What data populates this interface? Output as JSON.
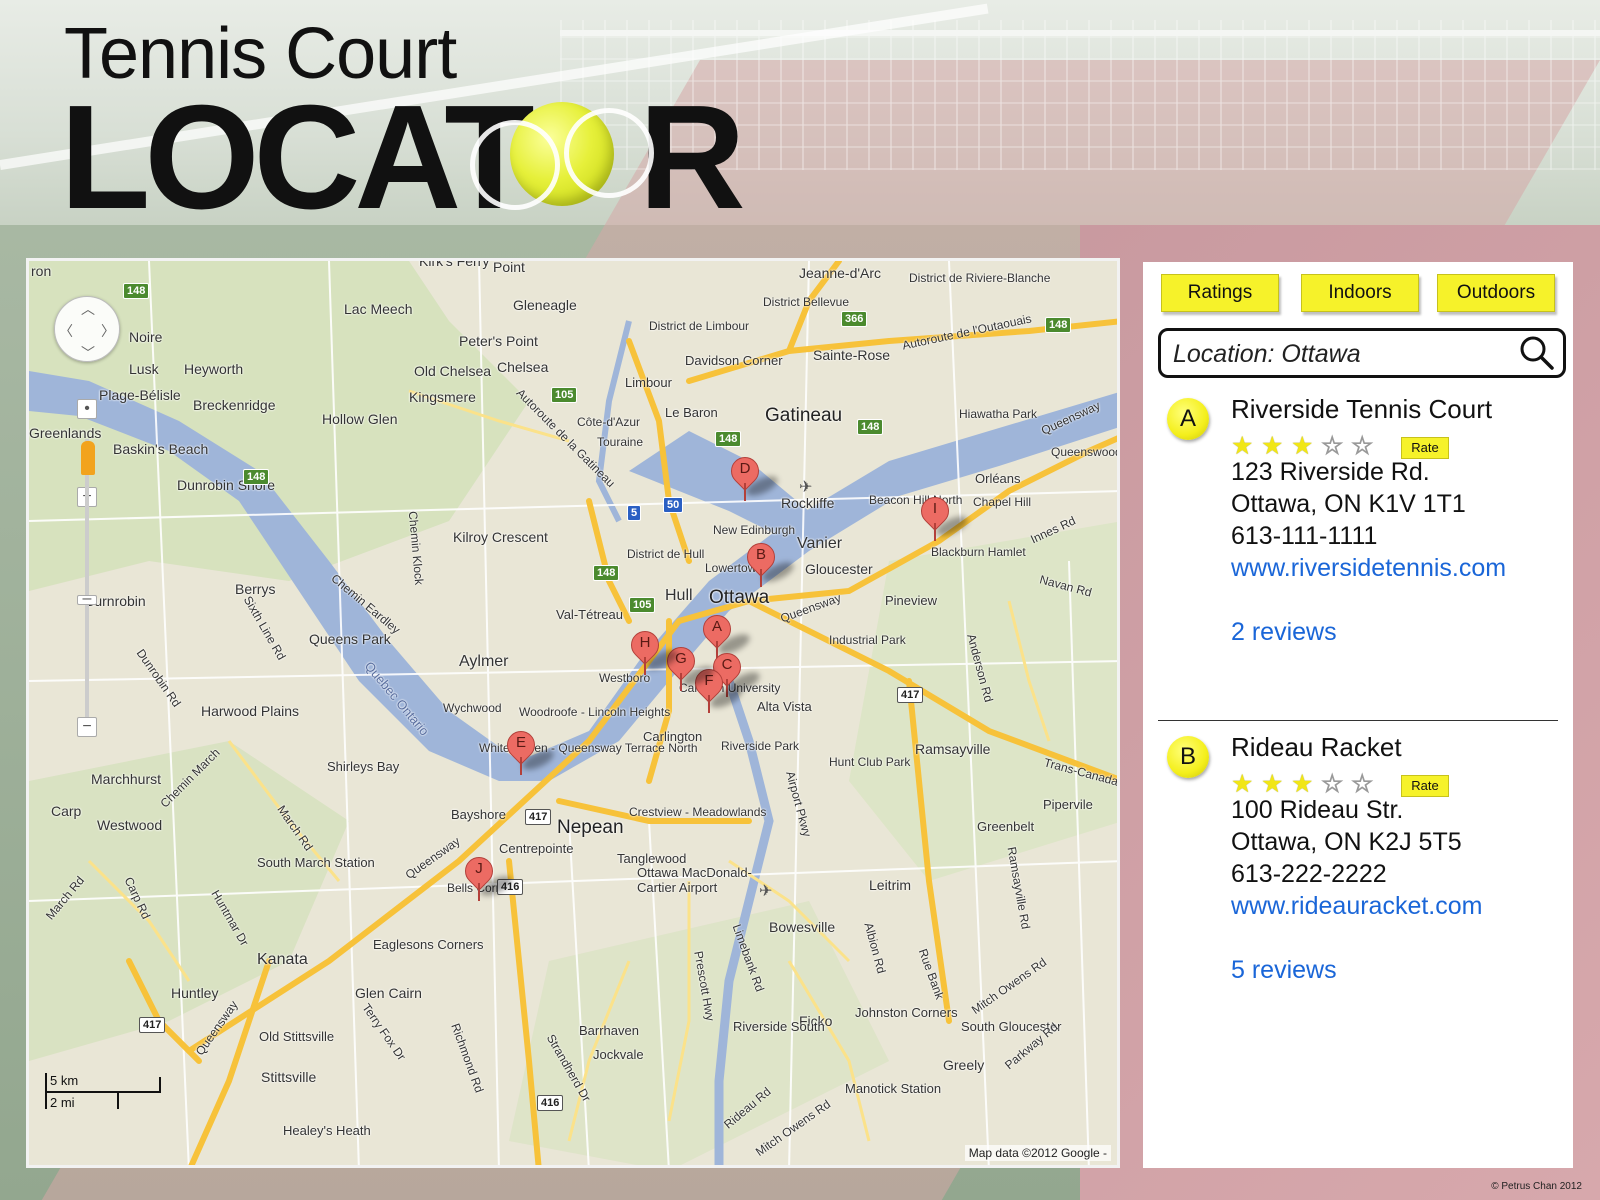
{
  "logo": {
    "line1": "Tennis Court",
    "line2_left": "LOCAT",
    "line2_right": "R"
  },
  "map": {
    "places": {
      "ottawa": "Ottawa",
      "gatineau": "Gatineau",
      "hull": "Hull",
      "nepean": "Nepean",
      "kanata": "Kanata",
      "aylmer": "Aylmer",
      "vanier": "Vanier",
      "gloucester": "Gloucester",
      "rockliffe": "Rockliffe",
      "orleans": "Orléans",
      "westboro": "Westboro",
      "carlington": "Carlington",
      "alta_vista": "Alta Vista",
      "riverside_park": "Riverside Park",
      "hunt_club_park": "Hunt Club Park",
      "ramsayville": "Ramsayville",
      "leitrim": "Leitrim",
      "bowesville": "Bowesville",
      "greenbelt": "Greenbelt",
      "pipervile": "Pipervile",
      "pineview": "Pineview",
      "industrial_park": "Industrial Park",
      "bayshore": "Bayshore",
      "centrepointe": "Centrepointe",
      "tanglewood": "Tanglewood",
      "crestview": "Crestview - Meadowlands",
      "shirleys_bay": "Shirleys Bay",
      "bells_corners": "Bells Corners",
      "eaglesons": "Eaglesons Corners",
      "glen_cairn": "Glen Cairn",
      "huntley": "Huntley",
      "old_stittsville": "Old Stittsville",
      "stittsville": "Stittsville",
      "healeys_heath": "Healey's Heath",
      "barrhaven": "Barrhaven",
      "jockvale": "Jockvale",
      "riverside_south": "Riverside South",
      "manotick": "Manotick Station",
      "ficko": "Ficko",
      "johnston": "Johnston Corners",
      "south_gloucester": "South Gloucester",
      "greely": "Greely",
      "airport": "Ottawa MacDonald-Cartier Airport",
      "carp": "Carp",
      "westwood": "Westwood",
      "marchhurst": "Marchhurst",
      "south_march": "South March Station",
      "harwood": "Harwood Plains",
      "queens_park": "Queens Park",
      "berrys": "Berrys",
      "burnt_robin": "Burnrobin",
      "kilroy": "Kilroy Crescent",
      "lac_meech": "Lac Meech",
      "hollow_glen": "Hollow Glen",
      "breckenridge": "Breckenridge",
      "plage": "Plage-Bélisle",
      "lusk": "Lusk",
      "heyworth": "Heyworth",
      "noire": "Noire",
      "baskins": "Baskin's Beach",
      "dunrobin": "Dunrobin Shore",
      "greenlands": "Greenlands",
      "old_chelsea": "Old Chelsea",
      "kingsmere": "Kingsmere",
      "chelsea": "Chelsea",
      "peters_point": "Peter's Point",
      "gleneagle": "Gleneagle",
      "limbour": "Limbour",
      "district_limbour": "District de Limbour",
      "davidson": "Davidson Corner",
      "le_baron": "Le Baron",
      "cote_azur": "Côte-d'Azur",
      "touraine": "Touraine",
      "district_hull": "District de Hull",
      "lowertown": "Lowertown",
      "new_edinburgh": "New Edinburgh",
      "val_tetreau": "Val-Tétreau",
      "woodroffe": "Woodroofe - Lincoln Heights",
      "wychwood": "Wychwood",
      "white_haven": "White Haven - Queensway Terrace North",
      "carleton": "Carleton University",
      "sainte_rose": "Sainte-Rose",
      "district_bellevue": "District Bellevue",
      "jeanne": "Jeanne-d'Arc",
      "riviere_blanche": "District de Riviere-Blanche",
      "hiawatha": "Hiawatha Park",
      "beacon_hill": "Beacon Hill North",
      "chapel_hill": "Chapel Hill",
      "blackburn": "Blackburn Hamlet",
      "queenswood": "Queenswood Heights",
      "kirks_ferry": "Kirk's Ferry",
      "point": "Point",
      "ron": "ron"
    },
    "roads": {
      "queensway": "Queensway",
      "autoroute_outaouais": "Autoroute de l'Outaouais",
      "autoroute_gatineau": "Autoroute de la Gatineau",
      "trans_canada": "Trans-Canada",
      "innes": "Innes Rd",
      "navan": "Navan Rd",
      "anderson": "Anderson Rd",
      "airport_pkwy": "Airport Pkwy",
      "prescott": "Prescott Hwy",
      "limebank": "Limebank Rd",
      "albion": "Albion Rd",
      "rue_bank": "Rue Bank",
      "mitch_owens": "Mitch Owens Rd",
      "ramsayville_rd": "Ramsayville Rd",
      "richmond": "Richmond Rd",
      "strandherd": "Strandherd Dr",
      "terry_fox": "Terry Fox Dr",
      "huntmar": "Huntmar Dr",
      "carp_rd": "Carp Rd",
      "march_rd": "March Rd",
      "dunrobin_rd": "Dunrobin Rd",
      "sixth_line": "Sixth Line Rd",
      "chemin_eardley": "Chemin Eardley",
      "chemin_klock": "Chemin Klock",
      "chemin_march": "Chemin March",
      "rideau_rd": "Rideau Rd",
      "parkway_rd": "Parkway Rd",
      "quebec_ontario": "Quebec Ontario"
    },
    "shields": [
      "148",
      "148",
      "148",
      "105",
      "105",
      "148",
      "148",
      "366",
      "148",
      "5",
      "50",
      "417",
      "417",
      "416",
      "416",
      "417"
    ],
    "pins": [
      "A",
      "B",
      "C",
      "D",
      "E",
      "F",
      "G",
      "H",
      "I",
      "J"
    ],
    "scale_km": "5 km",
    "scale_mi": "2 mi",
    "copyright": "Map data ©2012 Google -"
  },
  "filters": {
    "ratings": "Ratings",
    "indoors": "Indoors",
    "outdoors": "Outdoors"
  },
  "search": {
    "value": "Location: Ottawa",
    "icon": "magnifier-icon"
  },
  "results": [
    {
      "marker": "A",
      "name": "Riverside Tennis Court",
      "rating": 3,
      "max_rating": 5,
      "rate_label": "Rate",
      "street": "123 Riverside Rd.",
      "city": "Ottawa, ON K1V 1T1",
      "phone": "613-111-1111",
      "website": "www.riversidetennis.com",
      "reviews": "2 reviews"
    },
    {
      "marker": "B",
      "name": "Rideau Racket",
      "rating": 3,
      "max_rating": 5,
      "rate_label": "Rate",
      "street": "100 Rideau Str.",
      "city": "Ottawa, ON K2J 5T5",
      "phone": "613-222-2222",
      "website": "www.rideauracket.com",
      "reviews": "5 reviews"
    }
  ],
  "credit": "© Petrus Chan 2012",
  "colors": {
    "accent_yellow": "#f6f22a",
    "link_blue": "#1a66d8",
    "pin_red": "#ec6b63",
    "water": "#9fb5d9"
  }
}
